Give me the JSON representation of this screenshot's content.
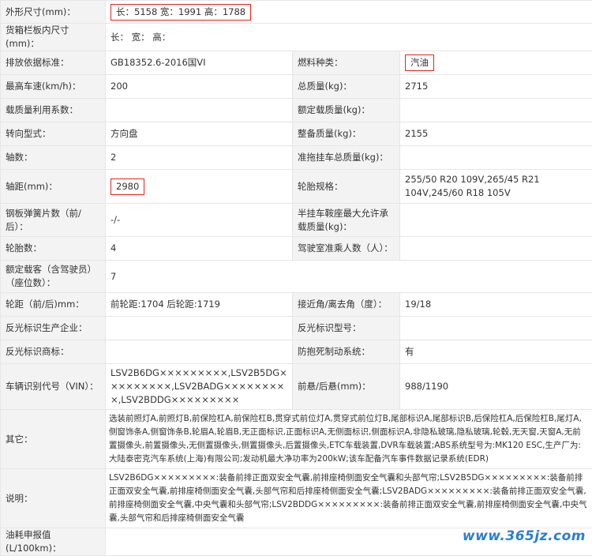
{
  "rows": {
    "dims": {
      "label": "外形尺寸(mm)：",
      "value": "长：5158 宽：1991 高：1788"
    },
    "cargo": {
      "label": "货箱栏板内尺寸(mm)：",
      "value": "长： 宽： 高："
    },
    "emission": {
      "label": "排放依据标准：",
      "value": "GB18352.6-2016国VI",
      "label2": "燃料种类：",
      "value2": "汽油"
    },
    "speed": {
      "label": "最高车速(km/h)：",
      "value": "200",
      "label2": "总质量(kg)：",
      "value2": "2715"
    },
    "loadfactor": {
      "label": "载质量利用系数：",
      "value": "",
      "label2": "额定载质量(kg)：",
      "value2": ""
    },
    "steering": {
      "label": "转向型式：",
      "value": "方向盘",
      "label2": "整备质量(kg)：",
      "value2": "2155"
    },
    "axles": {
      "label": "轴数：",
      "value": "2",
      "label2": "准拖挂车总质量(kg)：",
      "value2": ""
    },
    "wheelbase": {
      "label": "轴距(mm)：",
      "value": "2980",
      "label2": "轮胎规格：",
      "value2": "255/50 R20 109V,265/45 R21 104V,245/60 R18 105V"
    },
    "springs": {
      "label": "钢板弹簧片数（前/后）：",
      "value": "-/-",
      "label2": "半挂车鞍座最大允许承载质量(kg)：",
      "value2": ""
    },
    "tires": {
      "label": "轮胎数：",
      "value": "4",
      "label2": "驾驶室准乘人数（人）：",
      "value2": ""
    },
    "seats": {
      "label": "额定载客（含驾驶员）（座位数）：",
      "value": "7"
    },
    "track": {
      "label": "轮距（前/后)mm：",
      "value": "前轮距:1704 后轮距:1719",
      "label2": "接近角/离去角（度）：",
      "value2": "19/18"
    },
    "reflector_maker": {
      "label": "反光标识生产企业：",
      "value": "",
      "label2": "反光标识型号：",
      "value2": ""
    },
    "reflector_brand": {
      "label": "反光标识商标：",
      "value": "",
      "label2": "防抱死制动系统：",
      "value2": "有"
    },
    "vin": {
      "label": "车辆识别代号（VIN）：",
      "value": "LSV2B6DG×××××××××,LSV2B5DG×××××××××,LSV2BADG×××××××××,LSV2BDDG×××××××××",
      "label2": "前悬/后悬(mm)：",
      "value2": "988/1190"
    },
    "other": {
      "label": "其它：",
      "value": "选装前照灯A,前照灯B,前保险杠A,前保险杠B,贯穿式前位灯A,贯穿式前位灯B,尾部标识A,尾部标识B,后保险杠A,后保险杠B,尾灯A,侧窗饰条A,侧窗饰条B,轮眉A,轮眉B,无正面标识,正面标识A,无侧面标识,侧面标识A,非隐私玻璃,隐私玻璃,轮毂,无天窗,天窗A,无前置摄像头,前置摄像头,无侧置摄像头,侧置摄像头,后置摄像头,ETC车载装置,DVR车载装置;ABS系统型号为:MK120 ESC,生产厂为:大陆泰密克汽车系统(上海)有限公司;发动机最大净功率为200kW;该车配备汽车事件数据记录系统(EDR)"
    },
    "notes": {
      "label": "说明：",
      "value": "LSV2B6DG×××××××××:装备前排正面双安全气囊,前排座椅侧面安全气囊和头部气帘;LSV2B5DG×××××××××:装备前排正面双安全气囊,前排座椅侧面安全气囊,头部气帘和后排座椅侧面安全气囊;LSV2BADG×××××××××:装备前排正面双安全气囊,前排座椅侧面安全气囊,中央气囊和头部气帘;LSV2BDDG×××××××××:装备前排正面双安全气囊,前排座椅侧面安全气囊,中央气囊,头部气帘和后排座椅侧面安全气囊"
    },
    "fuel": {
      "label": "油耗申报值(L/100km)：",
      "value": ""
    }
  },
  "watermark": "www.365jz.com",
  "colors": {
    "highlight_border": "#e2241f",
    "label_bg": "#f3f3f3",
    "watermark": "#2a7fd1"
  }
}
